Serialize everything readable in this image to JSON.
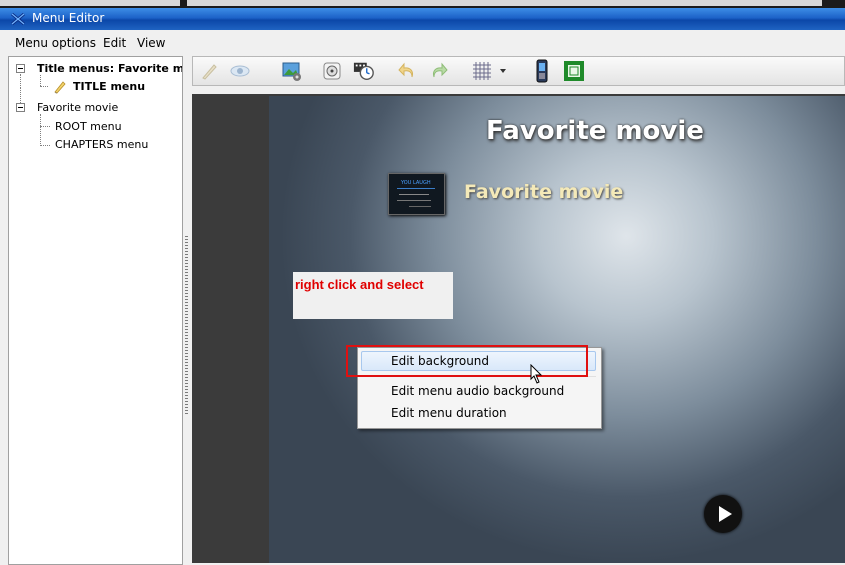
{
  "window": {
    "title": "Menu Editor"
  },
  "menubar": {
    "items": [
      "Menu options",
      "Edit",
      "View"
    ]
  },
  "tree": {
    "nodes": [
      {
        "label": "Title menus: Favorite mov"
      },
      {
        "label": "TITLE menu"
      },
      {
        "label": "Favorite movie"
      },
      {
        "label": "ROOT menu"
      },
      {
        "label": "CHAPTERS menu"
      }
    ]
  },
  "toolbar": {
    "icons": [
      "edit-pencil-icon",
      "preview-eye-icon",
      "background-image-icon",
      "audio-icon",
      "duration-clock-icon",
      "undo-icon",
      "redo-icon",
      "grid-icon",
      "grid-dropdown-icon",
      "phone-device-icon",
      "safe-area-icon"
    ]
  },
  "canvas": {
    "title_text": "Favorite movie",
    "button_text": "Favorite movie",
    "thumbnail_text": "YOU LAUGH"
  },
  "annotation": {
    "text": "right click and select"
  },
  "context_menu": {
    "items": [
      "Edit background",
      "Edit menu audio background",
      "Edit menu duration"
    ],
    "highlighted_index": 0
  },
  "colors": {
    "titlebar": "#1c62c8",
    "annotation_text": "#e00000",
    "highlight_border": "#e01010",
    "button_text": "#f4e9b8"
  }
}
